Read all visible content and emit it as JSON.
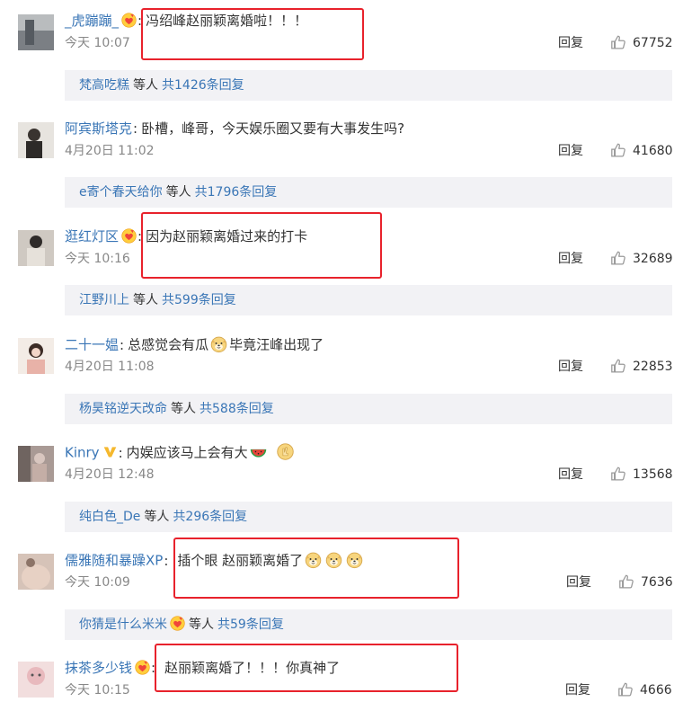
{
  "comments": [
    {
      "username": "_虎蹦蹦_",
      "badge": "heart-badge",
      "text": "冯绍峰赵丽颖离婚啦！！！",
      "time": "今天 10:07",
      "reply_label": "回复",
      "likes": "67752",
      "sub_user": "梵高吃糕",
      "sub_mid": "等人",
      "sub_count": "共1426条回复"
    },
    {
      "username": "阿宾斯塔克",
      "badge": "",
      "text": "卧槽，峰哥，今天娱乐圈又要有大事发生吗?",
      "time": "4月20日 11:02",
      "reply_label": "回复",
      "likes": "41680",
      "sub_user": "e寄个春天给你",
      "sub_mid": "等人",
      "sub_count": "共1796条回复"
    },
    {
      "username": "逛红灯区",
      "badge": "heart-badge",
      "text": "因为赵丽颖离婚过来的打卡",
      "time": "今天 10:16",
      "reply_label": "回复",
      "likes": "32689",
      "sub_user": "江野川上",
      "sub_mid": "等人",
      "sub_count": "共599条回复"
    },
    {
      "username": "二十一媪",
      "badge": "",
      "text_a": "总感觉会有瓜",
      "emoji": "doge-emoji",
      "text_b": "毕竟汪峰出现了",
      "time": "4月20日 11:08",
      "reply_label": "回复",
      "likes": "22853",
      "sub_user": "杨昊铭逆天改命",
      "sub_mid": "等人",
      "sub_count": "共588条回复"
    },
    {
      "username": "Kinry",
      "badge": "v-badge",
      "text": "内娱应该马上会有大",
      "emojis": [
        "watermelon-emoji",
        "peace-emoji"
      ],
      "time": "4月20日 12:48",
      "reply_label": "回复",
      "likes": "13568",
      "sub_user": "纯白色_De",
      "sub_mid": "等人",
      "sub_count": "共296条回复"
    },
    {
      "username": "儒雅随和暴躁XP",
      "badge": "",
      "text": "插个眼 赵丽颖离婚了",
      "emojis": [
        "doge-emoji",
        "doge-emoji",
        "doge-emoji"
      ],
      "time": "今天 10:09",
      "reply_label": "回复",
      "likes": "7636",
      "sub_user": "你猜是什么米米",
      "sub_user_badge": "heart-badge",
      "sub_mid": "等人",
      "sub_count": "共59条回复"
    },
    {
      "username": "抹茶多少钱",
      "badge": "heart-badge",
      "text": "赵丽颖离婚了！！！你真神了",
      "time": "今天 10:15",
      "reply_label": "回复",
      "likes": "4666"
    }
  ],
  "colors": {
    "link": "#3a76b6",
    "highlight_box": "#e8222c",
    "subbar_bg": "#f2f2f5",
    "muted": "#888888"
  }
}
